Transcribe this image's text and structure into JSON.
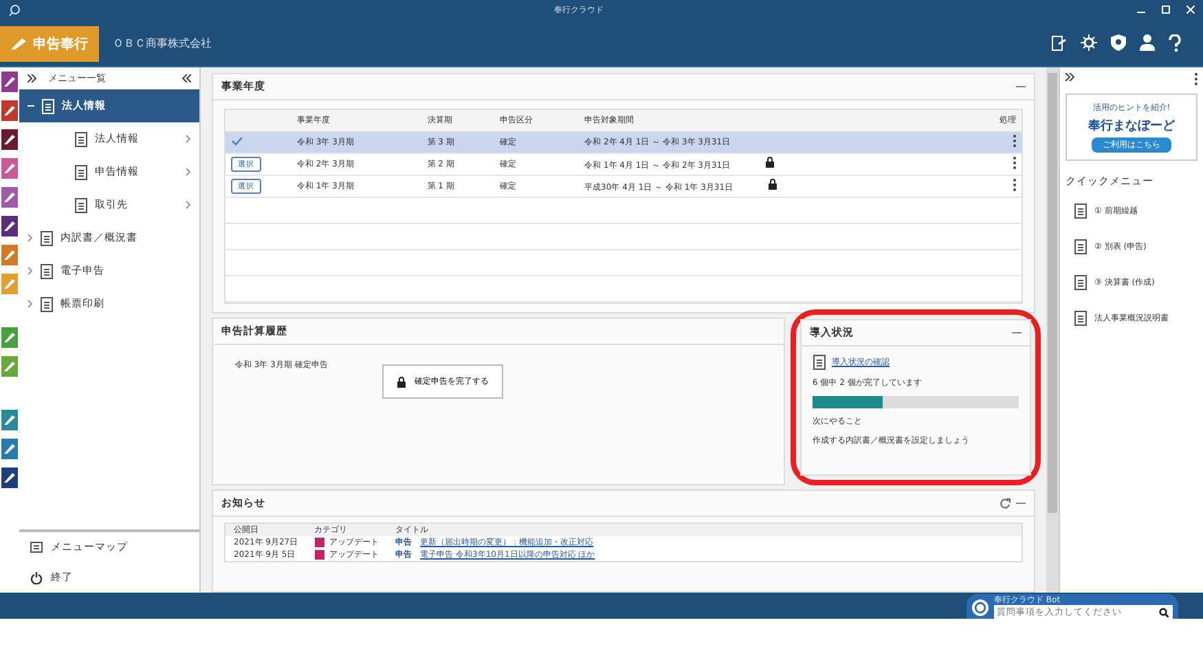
{
  "window": {
    "title": "奉行クラウド"
  },
  "header": {
    "product": "申告奉行",
    "company": "ＯＢＣ商事株式会社"
  },
  "app_tile_groups": [
    {
      "tiles": [
        {
          "color": "#8e3a8e"
        },
        {
          "color": "#c0392b"
        },
        {
          "color": "#6b1b2b"
        },
        {
          "color": "#c85a9a"
        },
        {
          "color": "#a05aa8"
        },
        {
          "color": "#5b2d7a"
        },
        {
          "color": "#d27a2a"
        },
        {
          "color": "#e0a030"
        }
      ]
    },
    {
      "tiles": [
        {
          "color": "#4aa040"
        },
        {
          "color": "#6aa83a"
        }
      ]
    },
    {
      "tiles": [
        {
          "color": "#2a8a9a"
        },
        {
          "color": "#2a7ab0"
        },
        {
          "color": "#1f3f7a"
        }
      ]
    }
  ],
  "sidebar": {
    "title": "メニュー一覧",
    "items": [
      {
        "label": "法人情報",
        "expanded": true,
        "selected": true,
        "children": [
          {
            "label": "法人情報",
            "selected": false
          },
          {
            "label": "申告情報",
            "selected": false
          },
          {
            "label": "取引先",
            "selected": false
          }
        ]
      },
      {
        "label": "内訳書／概況書",
        "expanded": false,
        "selected": false
      },
      {
        "label": "電子申告",
        "expanded": false,
        "selected": false
      },
      {
        "label": "帳票印刷",
        "expanded": false,
        "selected": false
      }
    ],
    "footer": [
      "メニューマップ",
      "終了"
    ]
  },
  "fiscal_years": {
    "title": "事業年度",
    "columns": [
      "事業年度",
      "決算期",
      "申告区分",
      "申告対象期間",
      "処理"
    ],
    "rows": [
      {
        "selected": true,
        "locked": false,
        "button": "",
        "year": "令和 3年 3月期",
        "term": "第 3 期",
        "type": "確定",
        "period": "令和 2年 4月 1日 ～ 令和 3年 3月31日"
      },
      {
        "selected": false,
        "locked": true,
        "button": "選択",
        "year": "令和 2年 3月期",
        "term": "第 2 期",
        "type": "確定",
        "period": "令和 1年 4月 1日 ～ 令和 2年 3月31日"
      },
      {
        "selected": false,
        "locked": true,
        "button": "選択",
        "year": "令和 1年 3月期",
        "term": "第 1 期",
        "type": "確定",
        "period": "平成30年 4月 1日 ～ 令和 1年 3月31日"
      }
    ]
  },
  "calc": {
    "title": "申告計算履歴",
    "status": "令和 3年 3月期 確定申告",
    "button": "確定申告を完了する"
  },
  "setup": {
    "title": "導入状況",
    "link": "導入状況の確認",
    "progress_text": "6 個中 2 個が完了しています",
    "level": 0.34,
    "next_label": "次にやること",
    "next_text": "作成する内訳書／概況書を設定しましょう"
  },
  "news": {
    "title": "お知らせ",
    "columns": [
      "公開日",
      "カテゴリ",
      "タイトル"
    ],
    "rows": [
      {
        "date": "2021年 9月27日",
        "category": "アップデート",
        "color": "#c0246a",
        "tag": "申告",
        "title": "更新（届出時期の変更）：機能追加・改正対応"
      },
      {
        "date": "2021年 9月 5日",
        "category": "アップデート",
        "color": "#c0246a",
        "tag": "申告",
        "title": "電子申告 令和3年10月1日以降の申告対応 ほか"
      }
    ]
  },
  "right_panel": {
    "banner": {
      "caption": "活用のヒントを紹介!",
      "title": "奉行まなぼーど",
      "button": "ご利用はこちら"
    },
    "quick_title": "クイックメニュー",
    "quick_items": [
      "① 前期繰越",
      "② 別表 (申告)",
      "③ 決算書 (作成)",
      "法人事業概況説明書"
    ]
  },
  "help": {
    "title": "奉行クラウド Bot",
    "placeholder": "質問事項を入力してください"
  }
}
